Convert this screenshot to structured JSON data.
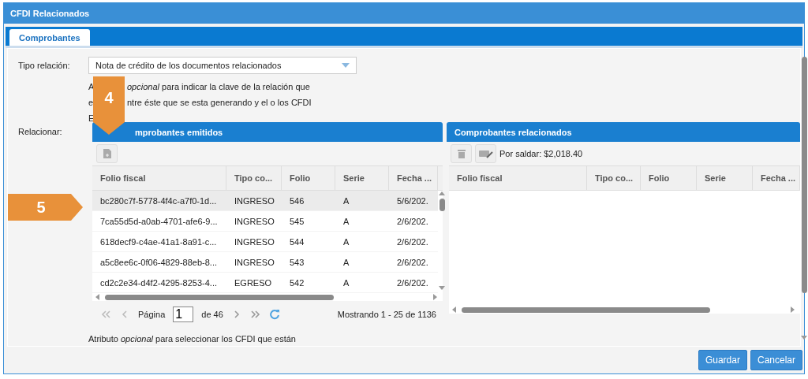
{
  "window": {
    "title": "CFDI Relacionados"
  },
  "tabs": [
    {
      "label": "Comprobantes",
      "selected": true
    }
  ],
  "tipo_relacion": {
    "label": "Tipo relación:",
    "value": "Nota de crédito de los documentos relacionados"
  },
  "description_lines": [
    {
      "before": "A",
      "after": "*opcional* para indicar la clave de la relación que"
    },
    {
      "before": "e",
      "after": "ntre éste que se esta generando y el o los CFDI"
    },
    {
      "before": "E"
    }
  ],
  "relacionar_label": "Relacionar:",
  "emitidos": {
    "title": "mprobantes emitidos",
    "columns": [
      "Folio fiscal",
      "Tipo co...",
      "Folio",
      "Serie",
      "Fecha ..."
    ],
    "rows": [
      {
        "cells": [
          "bc280c7f-5778-4f4c-a7f0-1d...",
          "INGRESO",
          "546",
          "A",
          "5/6/202."
        ],
        "selected": true
      },
      {
        "cells": [
          "7ca55d5d-a0ab-4701-afe6-9...",
          "INGRESO",
          "545",
          "A",
          "2/6/202."
        ],
        "selected": false
      },
      {
        "cells": [
          "618decf9-c4ae-41a1-8a91-c...",
          "INGRESO",
          "544",
          "A",
          "2/6/202."
        ],
        "selected": false
      },
      {
        "cells": [
          "a5c8ee6c-0f06-4829-88eb-8...",
          "INGRESO",
          "543",
          "A",
          "2/6/202."
        ],
        "selected": false
      },
      {
        "cells": [
          "cd2c2e34-d4f2-4295-8253-4...",
          "EGRESO",
          "542",
          "A",
          "2/6/202."
        ],
        "selected": false
      }
    ],
    "paging": {
      "page_label": "Página",
      "page": "1",
      "of": "de 46",
      "showing": "Mostrando 1 - 25 de 1136"
    }
  },
  "relacionados": {
    "title": "Comprobantes relacionados",
    "balance": "Por saldar: $2,018.40",
    "columns": [
      "Folio fiscal",
      "Tipo co...",
      "Folio",
      "Serie",
      "Fecha ..."
    ]
  },
  "footer_note": "Atributo *opcional* para seleccionar los CFDI que están",
  "buttons": [
    "Guardar",
    "Cancelar"
  ],
  "callouts": [
    {
      "label": "4",
      "kind": "down"
    },
    {
      "label": "5",
      "kind": "right"
    }
  ]
}
